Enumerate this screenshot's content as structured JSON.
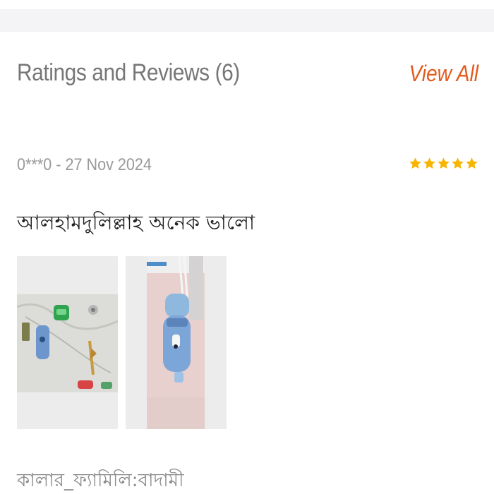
{
  "ratings": {
    "title": "Ratings and Reviews (6)",
    "view_all_label": "View All"
  },
  "review": {
    "meta": "0***0 - 27 Nov 2024",
    "rating": 5,
    "max_rating": 5,
    "body": "আলহামদুলিল্লাহ অনেক ভালো",
    "images": [
      {
        "icon": "review-photo"
      },
      {
        "icon": "review-photo"
      }
    ],
    "variant": "কালার_ফ্যামিলি:বাদামী"
  },
  "colors": {
    "accent": "#e4591c",
    "star": "#f7b500",
    "title_text": "#777777",
    "meta_text": "#9a9a9a",
    "body_text": "#222222"
  }
}
